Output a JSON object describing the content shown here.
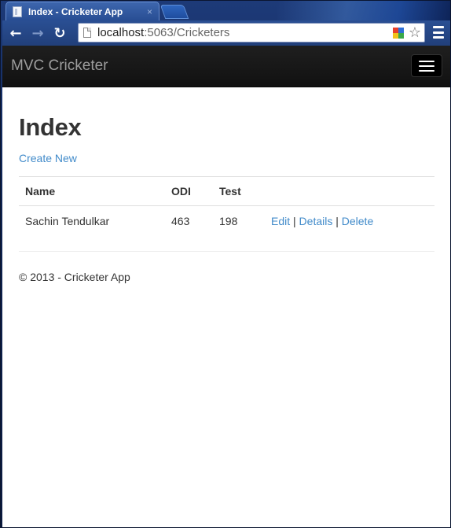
{
  "browser": {
    "tab_title": "Index - Cricketer App",
    "tab_close": "×",
    "url_host": "localhost",
    "url_rest": ":5063/Cricketers",
    "back_icon": "back-arrow-icon",
    "forward_icon": "forward-arrow-icon",
    "reload_icon": "reload-icon",
    "star_icon": "star-icon",
    "menu_icon": "hamburger-icon"
  },
  "navbar": {
    "brand": "MVC Cricketer",
    "background": "#1b1b1b",
    "brand_color": "#9d9d9d"
  },
  "page": {
    "title": "Index",
    "create_link": "Create New",
    "link_color": "#428bca"
  },
  "table": {
    "headers": [
      "Name",
      "ODI",
      "Test"
    ],
    "rows": [
      {
        "name": "Sachin Tendulkar",
        "odi": "463",
        "test": "198",
        "actions": [
          "Edit",
          "Details",
          "Delete"
        ]
      }
    ],
    "separator": "|"
  },
  "footer": {
    "text": "© 2013 - Cricketer App"
  }
}
